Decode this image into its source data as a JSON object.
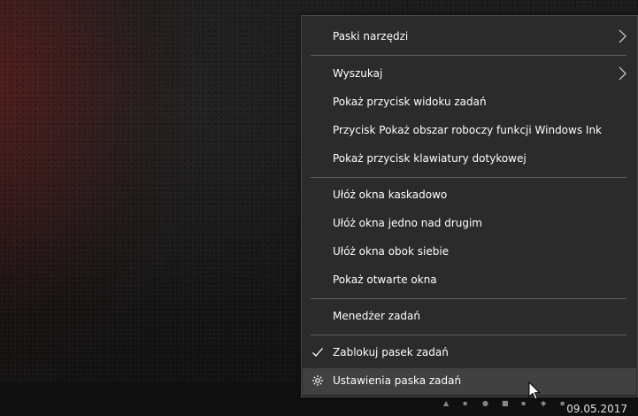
{
  "context_menu": {
    "items": [
      {
        "label": "Paski narzędzi",
        "has_submenu": true
      },
      {
        "label": "Wyszukaj",
        "has_submenu": true
      },
      {
        "label": "Pokaż przycisk widoku zadań"
      },
      {
        "label": "Przycisk Pokaż obszar roboczy funkcji Windows Ink"
      },
      {
        "label": "Pokaż przycisk klawiatury dotykowej"
      },
      {
        "label": "Ułóż okna kaskadowo"
      },
      {
        "label": "Ułóż okna jedno nad drugim"
      },
      {
        "label": "Ułóż okna obok siebie"
      },
      {
        "label": "Pokaż otwarte okna"
      },
      {
        "label": "Menedżer zadań"
      },
      {
        "label": "Zablokuj pasek zadań",
        "checked": true,
        "icon": "checkmark-icon"
      },
      {
        "label": "Ustawienia paska zadań",
        "highlighted": true,
        "icon": "gear-icon"
      }
    ]
  },
  "taskbar": {
    "date": "09.05.2017"
  },
  "colors": {
    "menu_background": "#2b2b2b",
    "menu_border": "#474747",
    "menu_hover": "#414141",
    "separator": "#5f5f5f",
    "text": "#ffffff",
    "taskbar": "#101010"
  }
}
